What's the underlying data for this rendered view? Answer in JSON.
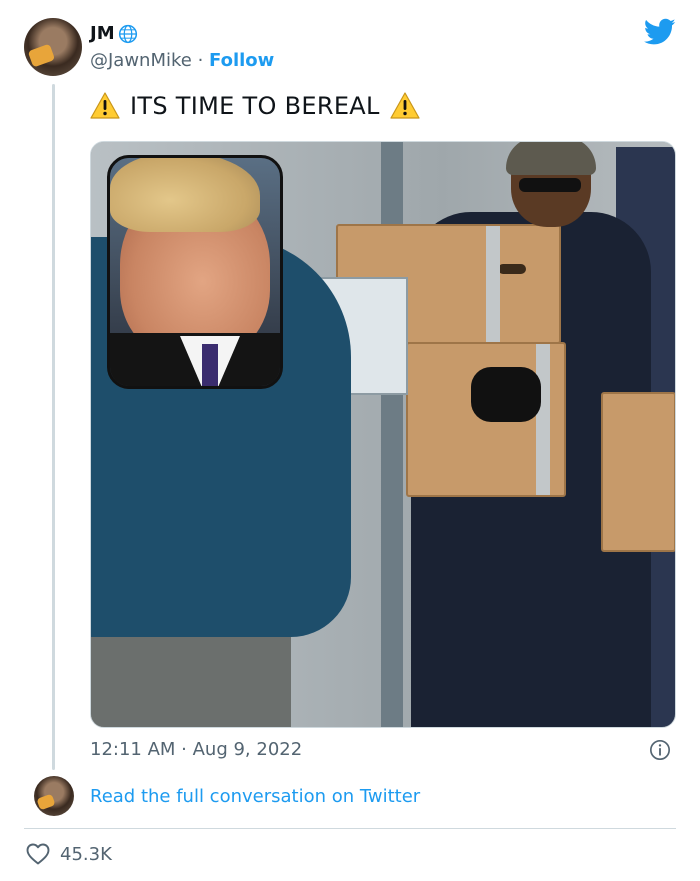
{
  "author": {
    "display_name": "JM",
    "handle": "@JawnMike",
    "separator": " · ",
    "follow_label": "Follow"
  },
  "tweet": {
    "text": "ITS TIME TO BEREAL",
    "timestamp": "12:11 AM · Aug 9, 2022"
  },
  "footer": {
    "read_link": "Read the full conversation on Twitter",
    "like_count": "45.3K"
  },
  "icons": {
    "brand": "twitter-bird-icon",
    "verified_badge": "globe-icon",
    "warning": "warning-icon",
    "info": "info-icon",
    "like": "heart-icon"
  },
  "colors": {
    "accent": "#1d9bf0",
    "text_primary": "#0f1419",
    "text_secondary": "#536471",
    "divider": "#cfd9de",
    "warning_fill": "#ffcc33"
  }
}
